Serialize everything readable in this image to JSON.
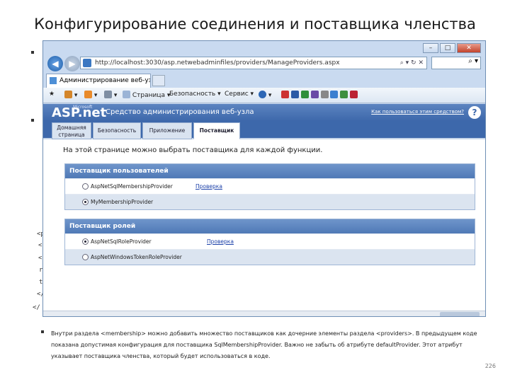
{
  "slide": {
    "title": "Конфигурирование соединения и поставщика членства",
    "code_fragments": [
      "<p",
      "<",
      "<",
      "r",
      "t",
      "</",
      "</"
    ],
    "body_text": "Внутри раздела <membership> можно добавить множество поставщиков как дочерние элементы раздела <providers>. В предыдущем коде показана допустимая конфигурация для поставщика SqlMembershipProvider. Важно не забыть об атрибуте defaultProvider. Этот атрибут указывает поставщика членства, который будет использоваться в коде.",
    "page_number": "226"
  },
  "browser": {
    "address": "http://localhost:3030/asp.netwebadminfiles/providers/ManageProviders.aspx",
    "tab_label": "Администрирование веб-уз...",
    "menu": {
      "page": "Страница",
      "security": "Безопасность",
      "service": "Сервис"
    }
  },
  "site": {
    "logo": "ASP.net",
    "logo_brand": "Microsoft",
    "title": "Средство администрирования веб-узла",
    "help_link": "Как пользоваться этим средством?",
    "help_icon": "?",
    "nav_tabs": [
      "Домашняя страница",
      "Безопасность",
      "Приложение",
      "Поставщик"
    ],
    "description": "На этой странице можно выбрать поставщика для каждой функции.",
    "user_providers": {
      "heading": "Поставщик пользователей",
      "rows": [
        {
          "name": "AspNetSqlMembershipProvider",
          "link": "Проверка",
          "selected": false
        },
        {
          "name": "MyMembershipProvider",
          "link": "",
          "selected": true
        }
      ]
    },
    "role_providers": {
      "heading": "Поставщик ролей",
      "rows": [
        {
          "name": "AspNetSqlRoleProvider",
          "link": "Проверка",
          "selected": true
        },
        {
          "name": "AspNetWindowsTokenRoleProvider",
          "link": "",
          "selected": false
        }
      ]
    }
  }
}
